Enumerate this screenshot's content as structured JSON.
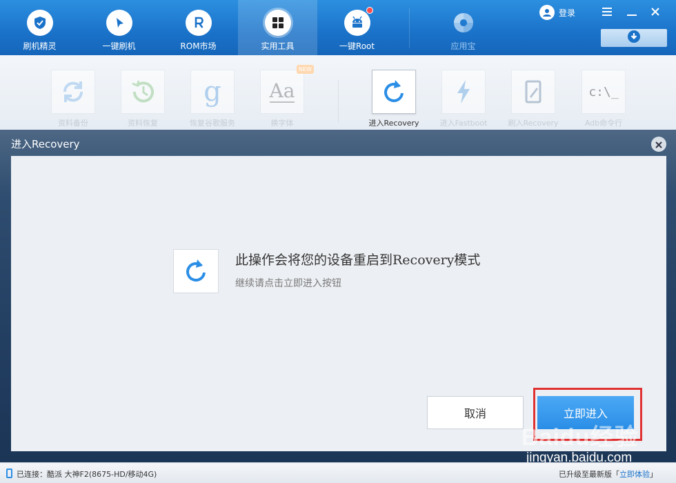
{
  "nav": {
    "items": [
      {
        "label": "刷机精灵",
        "icon": "shield-icon"
      },
      {
        "label": "一键刷机",
        "icon": "cursor-icon"
      },
      {
        "label": "ROM市场",
        "icon": "rom-r-icon"
      },
      {
        "label": "实用工具",
        "icon": "grid-icon",
        "active": true
      },
      {
        "label": "一键Root",
        "icon": "android-icon",
        "badge": true
      },
      {
        "label": "应用宝",
        "icon": "yingyongbao-logo-icon",
        "dimmed": true
      }
    ],
    "login_label": "登录"
  },
  "tools": {
    "new_badge": "NEW",
    "items": [
      {
        "label": "资料备份",
        "icon": "sync-icon"
      },
      {
        "label": "资料恢复",
        "icon": "history-icon"
      },
      {
        "label": "恢复谷歌服务",
        "icon": "google-icon"
      },
      {
        "label": "换字体",
        "icon": "font-aa-icon"
      },
      {
        "label": "进入Recovery",
        "icon": "refresh-icon",
        "active": true
      },
      {
        "label": "进入Fastboot",
        "icon": "lightning-icon"
      },
      {
        "label": "刷入Recovery",
        "icon": "tablet-edit-icon"
      },
      {
        "label": "Adb命令行",
        "icon": "terminal-icon"
      }
    ],
    "icon_glyphs": {
      "google": "g",
      "font": "Aa",
      "terminal": "c:\\_"
    }
  },
  "dialog": {
    "title": "进入Recovery",
    "message": "此操作会将您的设备重启到Recovery模式",
    "sub_message": "继续请点击立即进入按钮",
    "cancel_label": "取消",
    "confirm_label": "立即进入"
  },
  "watermark": {
    "text": "Baidu经验",
    "url": "jingyan.baidu.com"
  },
  "status": {
    "connected_prefix": "已连接：",
    "device": "酷派 大神F2(8675-HD/移动4G)",
    "update_text": "已升级至最新版「",
    "update_link": "立即体验",
    "update_suffix": "」"
  },
  "colors": {
    "accent": "#2b8ee6",
    "nav_bg": "#1a72c9",
    "highlight": "#e03232"
  }
}
